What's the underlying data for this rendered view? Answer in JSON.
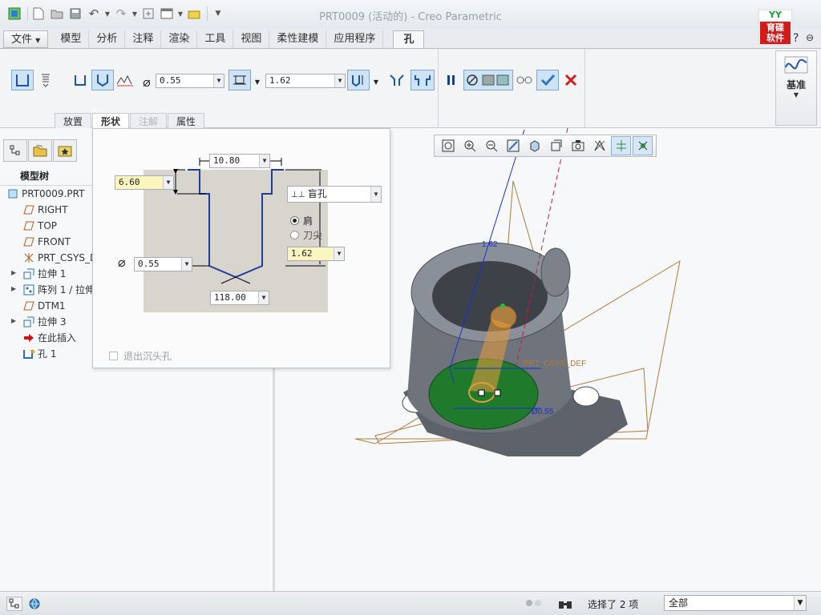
{
  "window": {
    "title": "PRT0009 (活动的) - Creo Parametric"
  },
  "logo": {
    "top": "YY",
    "bottom_line1": "育碟",
    "bottom_line2": "软件"
  },
  "ribbon": {
    "tabs": [
      {
        "label": "文件"
      },
      {
        "label": "模型"
      },
      {
        "label": "分析"
      },
      {
        "label": "注释"
      },
      {
        "label": "渲染"
      },
      {
        "label": "工具"
      },
      {
        "label": "视图"
      },
      {
        "label": "柔性建模"
      },
      {
        "label": "应用程序"
      },
      {
        "label": "孔"
      }
    ],
    "diameter_symbol": "⌀",
    "diameter_value": "0.55",
    "depth_value": "1.62",
    "subtabs": [
      {
        "label": "放置"
      },
      {
        "label": "形状"
      },
      {
        "label": "注解"
      },
      {
        "label": "属性"
      }
    ],
    "datum_label": "基准"
  },
  "model_tree": {
    "title": "模型树",
    "items": [
      {
        "label": "PRT0009.PRT"
      },
      {
        "label": "RIGHT"
      },
      {
        "label": "TOP"
      },
      {
        "label": "FRONT"
      },
      {
        "label": "PRT_CSYS_D"
      },
      {
        "label": "拉伸 1"
      },
      {
        "label": "阵列 1 / 拉伸"
      },
      {
        "label": "DTM1"
      },
      {
        "label": "拉伸 3"
      },
      {
        "label": "在此插入"
      },
      {
        "label": "孔 1"
      }
    ]
  },
  "shape_panel": {
    "top_width_value": "10.80",
    "countersink_depth_value": "6.60",
    "depth_type_label": "盲孔",
    "radio_shoulder": "肩",
    "radio_tip": "刀尖",
    "depth_value": "1.62",
    "diameter_value": "0.55",
    "angle_value": "118.00",
    "exit_countersink_label": "退出沉头孔"
  },
  "viewport": {
    "dim_label_depth": "1.62",
    "csys_label": "PRT_CSYS_DEF",
    "dim_label_diameter": "Ø0.55"
  },
  "status_bar": {
    "selection_text": "选择了 2 项",
    "filter_value": "全部"
  },
  "colors": {
    "ribbon_bg": "#f3f4f6",
    "model_gray": "#6f747c",
    "hole_orange": "#e09a40",
    "placement_green": "#1f7a2c",
    "datum_brown": "#b07a3a",
    "axis_blue": "#1b2fd8",
    "cancel_red": "#d01c1c",
    "ok_blue": "#2b78c2"
  }
}
